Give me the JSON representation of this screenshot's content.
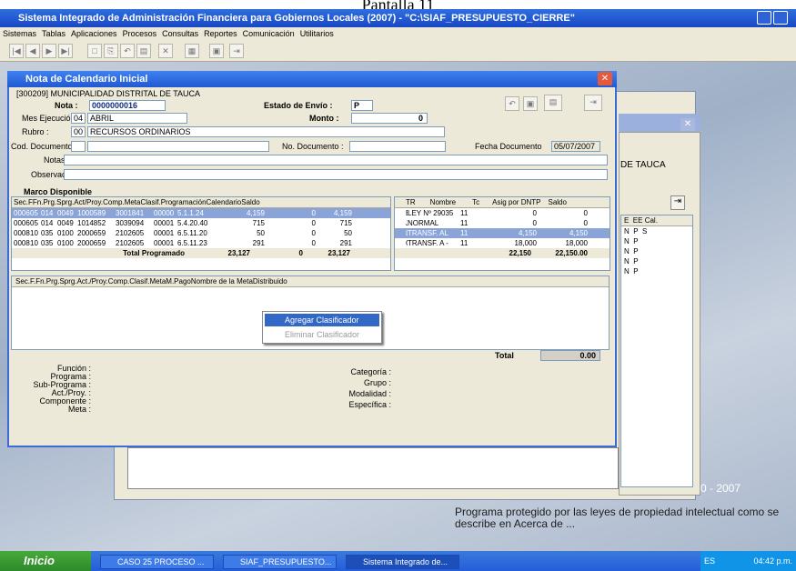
{
  "caption": "Pantalla 11",
  "app": {
    "title": "Sistema Integrado de Administración Financiera para Gobiernos Locales (2007) - \"C:\\SIAF_PRESUPUESTO_CIERRE\""
  },
  "menu": [
    "Sistemas",
    "Tablas",
    "Aplicaciones",
    "Procesos",
    "Consultas",
    "Reportes",
    "Comunicación",
    "Utilitarios"
  ],
  "window": {
    "title": "Nota de Calendario Inicial"
  },
  "form": {
    "entity": "[300209] MUNICIPALIDAD DISTRITAL DE TAUCA",
    "nota_label": "Nota :",
    "nota": "0000000016",
    "estado_label": "Estado de Envío :",
    "estado": "P",
    "mes_label": "Mes Ejecución :",
    "mes_code": "04",
    "mes": "ABRIL",
    "monto_label": "Monto :",
    "monto": "0",
    "rubro_label": "Rubro :",
    "rubro_code": "00",
    "rubro": "RECURSOS ORDINARIOS",
    "coddoc_label": "Cod. Documento :",
    "nodoc_label": "No. Documento :",
    "fechadoc_label": "Fecha Documento",
    "fechadoc": "05/07/2007",
    "notas_label": "Notas :",
    "obs_label": "Observación :"
  },
  "marco": {
    "title": "Marco Disponible",
    "headers": [
      "Sec.F",
      "Fn.",
      "Prg.",
      "Sprg.",
      "Act/Proy.",
      "Comp.",
      "Meta",
      "Clasif.",
      "Programación",
      "Calendario",
      "Saldo"
    ],
    "rows": [
      [
        "0006",
        "05",
        "014",
        "0049",
        "1000589",
        "3001841",
        "00000",
        "5.1.1.24",
        "4,159",
        "0",
        "4,159"
      ],
      [
        "0006",
        "05",
        "014",
        "0049",
        "1014852",
        "3039094",
        "00001",
        "5.4.20.40",
        "715",
        "0",
        "715"
      ],
      [
        "0008",
        "10",
        "035",
        "0100",
        "2000659",
        "2102605",
        "00001",
        "6.5.11.20",
        "50",
        "0",
        "50"
      ],
      [
        "0008",
        "10",
        "035",
        "0100",
        "2000659",
        "2102605",
        "00001",
        "6.5.11.23",
        "291",
        "0",
        "291"
      ]
    ],
    "total_label": "Total Programado",
    "total_prog": "23,127",
    "total_cal": "0",
    "total_saldo": "23,127"
  },
  "right_grid": {
    "headers": [
      "TR",
      "Nombre",
      "Tc",
      "Asig por DNTP",
      "Saldo"
    ],
    "rows": [
      [
        "E",
        "LEY Nº 29035",
        "11",
        "0",
        "0"
      ],
      [
        "J",
        "NORMAL",
        "11",
        "0",
        "0"
      ],
      [
        "L",
        "TRANSF. AL",
        "11",
        "4,150",
        "4,150"
      ],
      [
        "O",
        "TRANSF. A -",
        "11",
        "18,000",
        "18,000"
      ]
    ],
    "total_asig": "22,150",
    "total_saldo": "22,150.00"
  },
  "lower": {
    "headers": [
      "Sec.F.",
      "Fn.",
      "Prg.",
      "Sprg.",
      "Act./Proy.",
      "Comp.",
      "Clasif.",
      "Meta",
      "M.Pago",
      "Nombre de la Meta",
      "Distribuido"
    ],
    "total_label": "Total",
    "total": "0.00"
  },
  "context_menu": [
    "Agregar Clasificador",
    "Eliminar Clasificador"
  ],
  "info": {
    "left": [
      "Función :",
      "Programa :",
      "Sub-Programa :",
      "Act./Proy. :",
      "Componente :",
      "Meta :"
    ],
    "right": [
      "Categoría :",
      "Grupo :",
      "Modalidad :",
      "Específica :"
    ]
  },
  "background": {
    "entity": "DE TAUCA",
    "headers": [
      "E",
      "EE",
      "Cal."
    ],
    "rows": [
      [
        "N",
        "P",
        "S"
      ],
      [
        "N",
        "P",
        ""
      ],
      [
        "N",
        "P",
        ""
      ],
      [
        "N",
        "P",
        ""
      ],
      [
        "N",
        "P",
        ""
      ]
    ],
    "year": "0 - 2007",
    "notice": "Programa protegido por las leyes de propiedad intelectual como se describe en Acerca de ..."
  },
  "taskbar": {
    "start": "Inicio",
    "tasks": [
      "CASO 25 PROCESO ...",
      "SIAF_PRESUPUESTO...",
      "Sistema Integrado de..."
    ],
    "lang": "ES",
    "time": "04:42 p.m."
  }
}
